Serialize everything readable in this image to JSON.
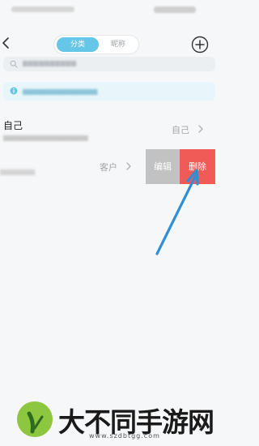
{
  "header": {
    "tabs": [
      {
        "label": "分类",
        "active": true
      },
      {
        "label": "昵称",
        "active": false
      }
    ]
  },
  "list": {
    "row_self": {
      "title": "自己",
      "value": "自己"
    },
    "row_client": {
      "value": "客户",
      "actions": {
        "edit_label": "编辑",
        "delete_label": "删除"
      }
    }
  },
  "annotation": {
    "arrow_color": "#2f8ed8"
  },
  "watermark": {
    "title": "大不同手游网",
    "url": "www.szdbtgg.com"
  },
  "colors": {
    "accent": "#66c6e8",
    "delete": "#f05a57",
    "edit": "#c2c2c2"
  },
  "icons": [
    "back-icon",
    "add-icon",
    "search-icon",
    "info-icon",
    "chevron-right-icon"
  ]
}
